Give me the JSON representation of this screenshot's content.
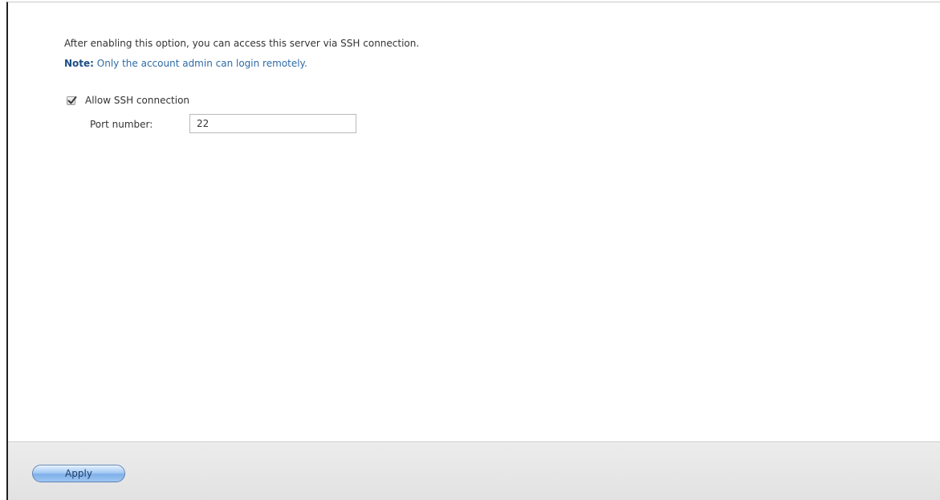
{
  "ssh_settings": {
    "description": "After enabling this option, you can access this server via SSH connection.",
    "note_label": "Note:",
    "note_text": " Only the account admin can login remotely.",
    "allow_ssh": {
      "label": "Allow SSH connection",
      "checked": true,
      "icon": "checkmark-icon"
    },
    "port": {
      "label": "Port number:",
      "value": "22"
    }
  },
  "footer": {
    "apply_label": "Apply"
  },
  "colors": {
    "note_text": "#2e6aa6",
    "note_label": "#1d4f86",
    "button_blue": "#7fb0ea",
    "footer_bg": "#e6e6e6"
  }
}
